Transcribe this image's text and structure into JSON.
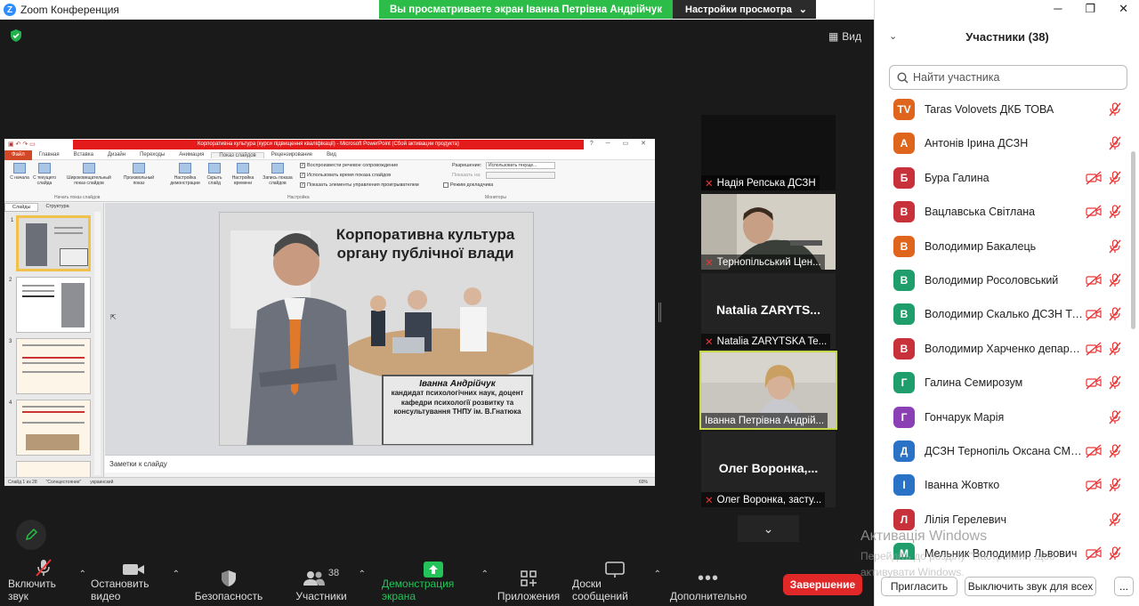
{
  "window": {
    "title": "Zoom Конференция",
    "logo_letter": "Z"
  },
  "share_banner": {
    "text": "Вы просматриваете экран Іванна Петрівна Андрійчук",
    "options_label": "Настройки просмотра"
  },
  "meeting": {
    "view_label": "Вид"
  },
  "ppt": {
    "title": "Корпоративна культура (курси підвищення кваліфікації) - Microsoft PowerPoint (Сбой активации продукта)",
    "tabs": [
      "Файл",
      "Главная",
      "Вставка",
      "Дизайн",
      "Переходы",
      "Анимация",
      "Показ слайдов",
      "Рецензирование",
      "Вид"
    ],
    "ribbon": {
      "from_start": "С начала",
      "from_current": "С текущего слайда",
      "broadcast": "Широковещательный показ слайдов",
      "custom": "Произвольный показ",
      "group1": "Начать показ слайдов",
      "setup": "Настройка демонстрации",
      "hide": "Скрыть слайд",
      "timings": "Настройка времени",
      "record": "Запись показа слайдов",
      "group2": "Настройка",
      "check1": "Воспроизвести речевое сопровождение",
      "check2": "Использовать время показа слайдов",
      "check3": "Показать элементы управления проигрывателем",
      "resolution_label": "Разрешение:",
      "resolution_value": "Использовать текуще...",
      "show_on": "Показать на:",
      "presenter_view": "Режим докладчика",
      "group3": "Мониторы"
    },
    "left_tabs": [
      "Слайды",
      "Структура"
    ],
    "slide_numbers": [
      "1",
      "2",
      "3",
      "4"
    ],
    "slide": {
      "title": "Корпоративна культура органу публічної влади",
      "author": "Іванна Андрійчук",
      "desc": "кандидат психологічних наук, доцент кафедри психології розвитку та консультування ТНПУ ім. В.Гнатюка"
    },
    "notes_placeholder": "Заметки к слайду",
    "status": {
      "slide": "Слайд 1 из 28",
      "theme": "\"Солнцестояние\"",
      "lang": "украинский",
      "zoom": "69%"
    }
  },
  "videos": [
    {
      "name": "Надія Репська ДСЗН",
      "big": "",
      "muted": true
    },
    {
      "name": "Тернопільський Цен...",
      "big": "",
      "muted": true
    },
    {
      "name": "Natalia ZARYTSKA Te...",
      "big": "Natalia  ZARYTS...",
      "muted": true
    },
    {
      "name": "Іванна Петрівна Андрій...",
      "big": "",
      "muted": false
    },
    {
      "name": "Олег Воронка, засту...",
      "big": "Олег  Воронка,...",
      "muted": true
    }
  ],
  "toolbar": {
    "audio": "Включить звук",
    "video": "Остановить видео",
    "security": "Безопасность",
    "participants": "Участники",
    "participants_count": "38",
    "share": "Демонстрация экрана",
    "apps": "Приложения",
    "whiteboards": "Доски сообщений",
    "more": "Дополнительно",
    "end": "Завершение"
  },
  "panel": {
    "title": "Участники (38)",
    "search_placeholder": "Найти участника",
    "invite": "Пригласить",
    "mute_all": "Выключить звук для всех",
    "more": "..."
  },
  "participants": [
    {
      "initials": "TV",
      "color": "#e0651c",
      "name": "Taras Volovets ДКБ ТОВА",
      "cam_off": false
    },
    {
      "initials": "А",
      "color": "#e0651c",
      "name": "Антонів Ірина ДСЗН",
      "cam_off": false
    },
    {
      "initials": "Б",
      "color": "#c8303a",
      "name": "Бура Галина",
      "cam_off": true
    },
    {
      "initials": "В",
      "color": "#c8303a",
      "name": "Вацлавська Світлана",
      "cam_off": true
    },
    {
      "initials": "В",
      "color": "#e0651c",
      "name": "Володимир Бакалець",
      "cam_off": false
    },
    {
      "initials": "В",
      "color": "#1f9e6b",
      "name": "Володимир Росоловський",
      "cam_off": true
    },
    {
      "initials": "В",
      "color": "#1f9e6b",
      "name": "Володимир Скалько ДСЗН Те...",
      "cam_off": true
    },
    {
      "initials": "В",
      "color": "#c8303a",
      "name": "Володимир Харченко департа...",
      "cam_off": true
    },
    {
      "initials": "Г",
      "color": "#1f9e6b",
      "name": "Галина Семирозум",
      "cam_off": true
    },
    {
      "initials": "Г",
      "color": "#8a3fb5",
      "name": "Гончарук Марія",
      "cam_off": false
    },
    {
      "initials": "Д",
      "color": "#2a72c5",
      "name": "ДСЗН Тернопіль Оксана СМО...",
      "cam_off": true
    },
    {
      "initials": "І",
      "color": "#2a72c5",
      "name": "Іванна Жовтко",
      "cam_off": true
    },
    {
      "initials": "Л",
      "color": "#c8303a",
      "name": "Лілія Герелевич",
      "cam_off": false
    },
    {
      "initials": "М",
      "color": "#1f9e6b",
      "name": "Мельник Володимир Львович",
      "cam_off": true
    }
  ],
  "watermark": {
    "line1": "Активація Windows",
    "line2": "Перейдіть до розділу \"Настройки\", щоб",
    "line3": "активувати Windows."
  }
}
